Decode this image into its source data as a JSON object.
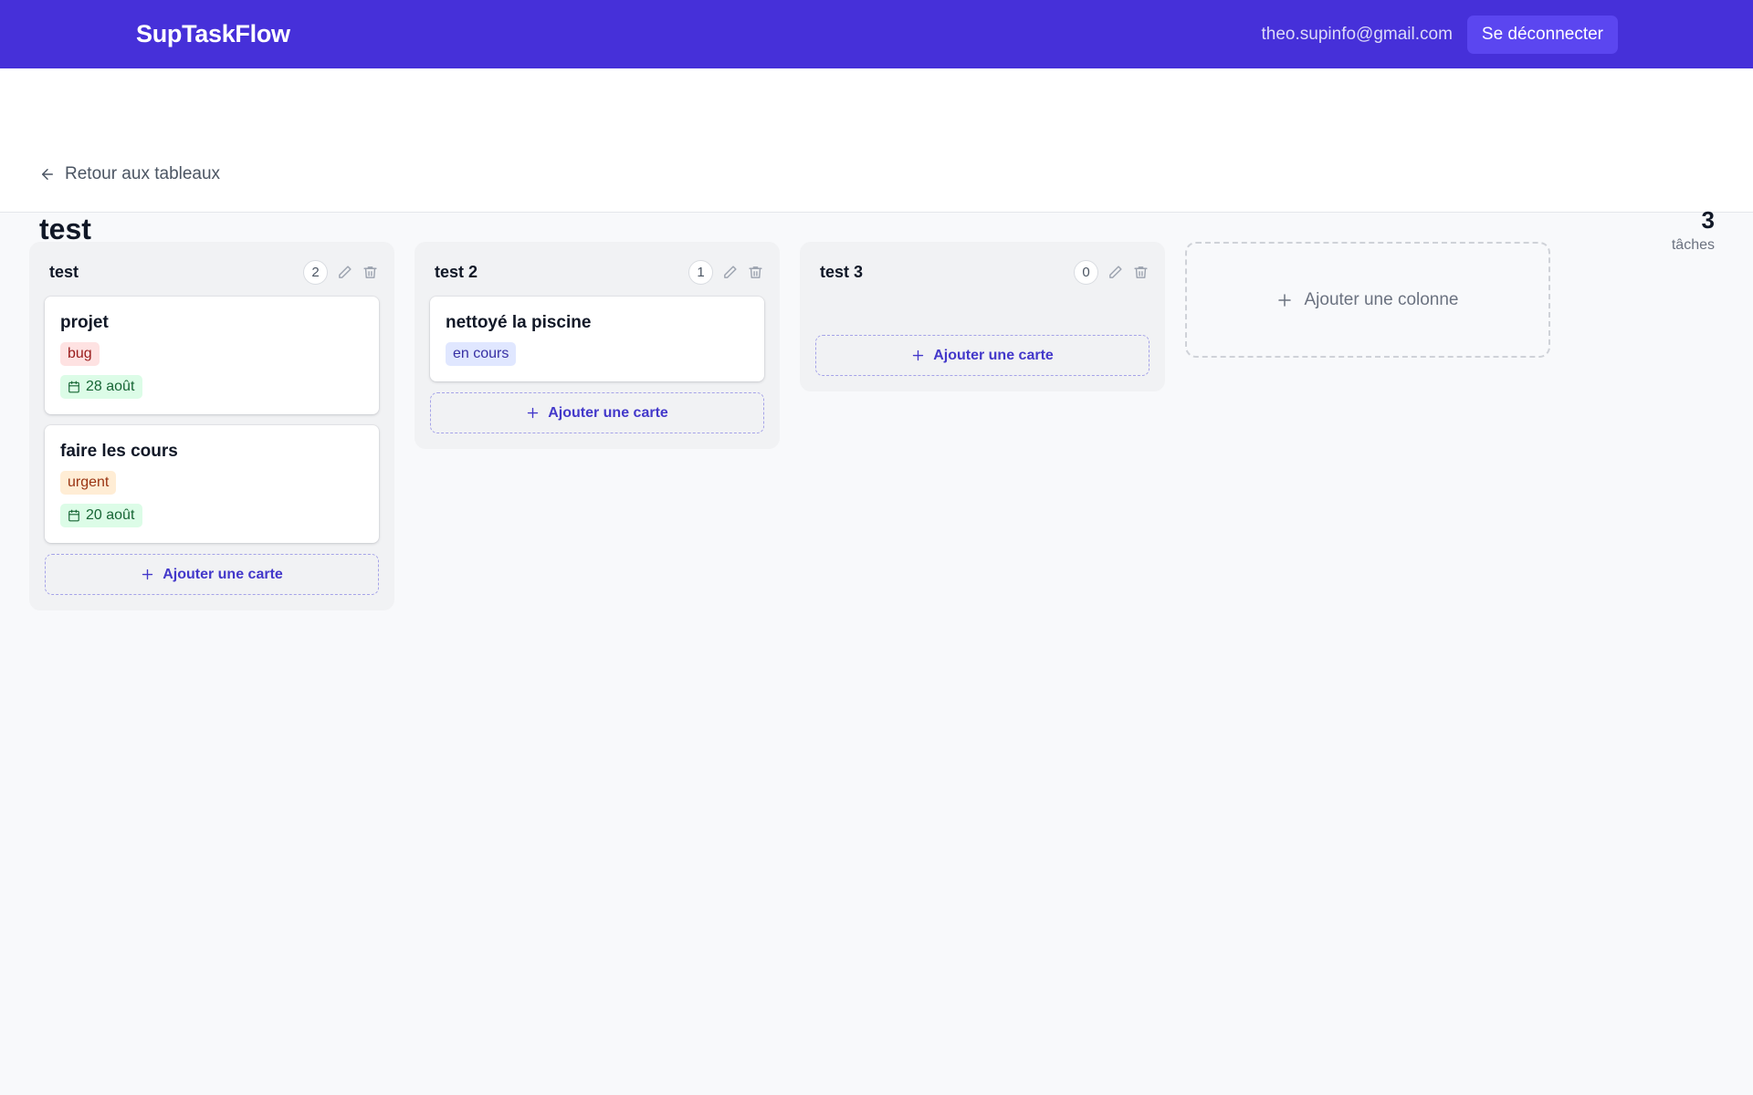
{
  "app": {
    "logo": "SupTaskFlow",
    "user_email": "theo.supinfo@gmail.com",
    "logout_label": "Se déconnecter",
    "brand_color": "#4630d9"
  },
  "board": {
    "back_label": "Retour aux tableaux",
    "title": "test",
    "task_count": "3",
    "task_count_label": "tâches"
  },
  "columns": [
    {
      "title": "test",
      "count": "2",
      "cards": [
        {
          "title": "projet",
          "tag": "bug",
          "tag_color": "#fee2e2",
          "tag_text_color": "#991b1b",
          "due": "28 août"
        },
        {
          "title": "faire les cours",
          "tag": "urgent",
          "tag_color": "#ffedd5",
          "tag_text_color": "#9a3412",
          "due": "20 août"
        }
      ],
      "add_card_label": "Ajouter une carte"
    },
    {
      "title": "test 2",
      "count": "1",
      "cards": [
        {
          "title": "nettoyé la piscine",
          "tag": "en cours",
          "tag_color": "#e0e7ff",
          "tag_text_color": "#3730a3"
        }
      ],
      "add_card_label": "Ajouter une carte"
    },
    {
      "title": "test 3",
      "count": "0",
      "cards": [],
      "add_card_label": "Ajouter une carte"
    }
  ],
  "add_column_label": "Ajouter une colonne",
  "icons": {
    "back": "arrow-left-icon",
    "edit": "pencil-icon",
    "delete": "trash-icon",
    "due": "calendar-icon",
    "add": "plus-icon"
  }
}
